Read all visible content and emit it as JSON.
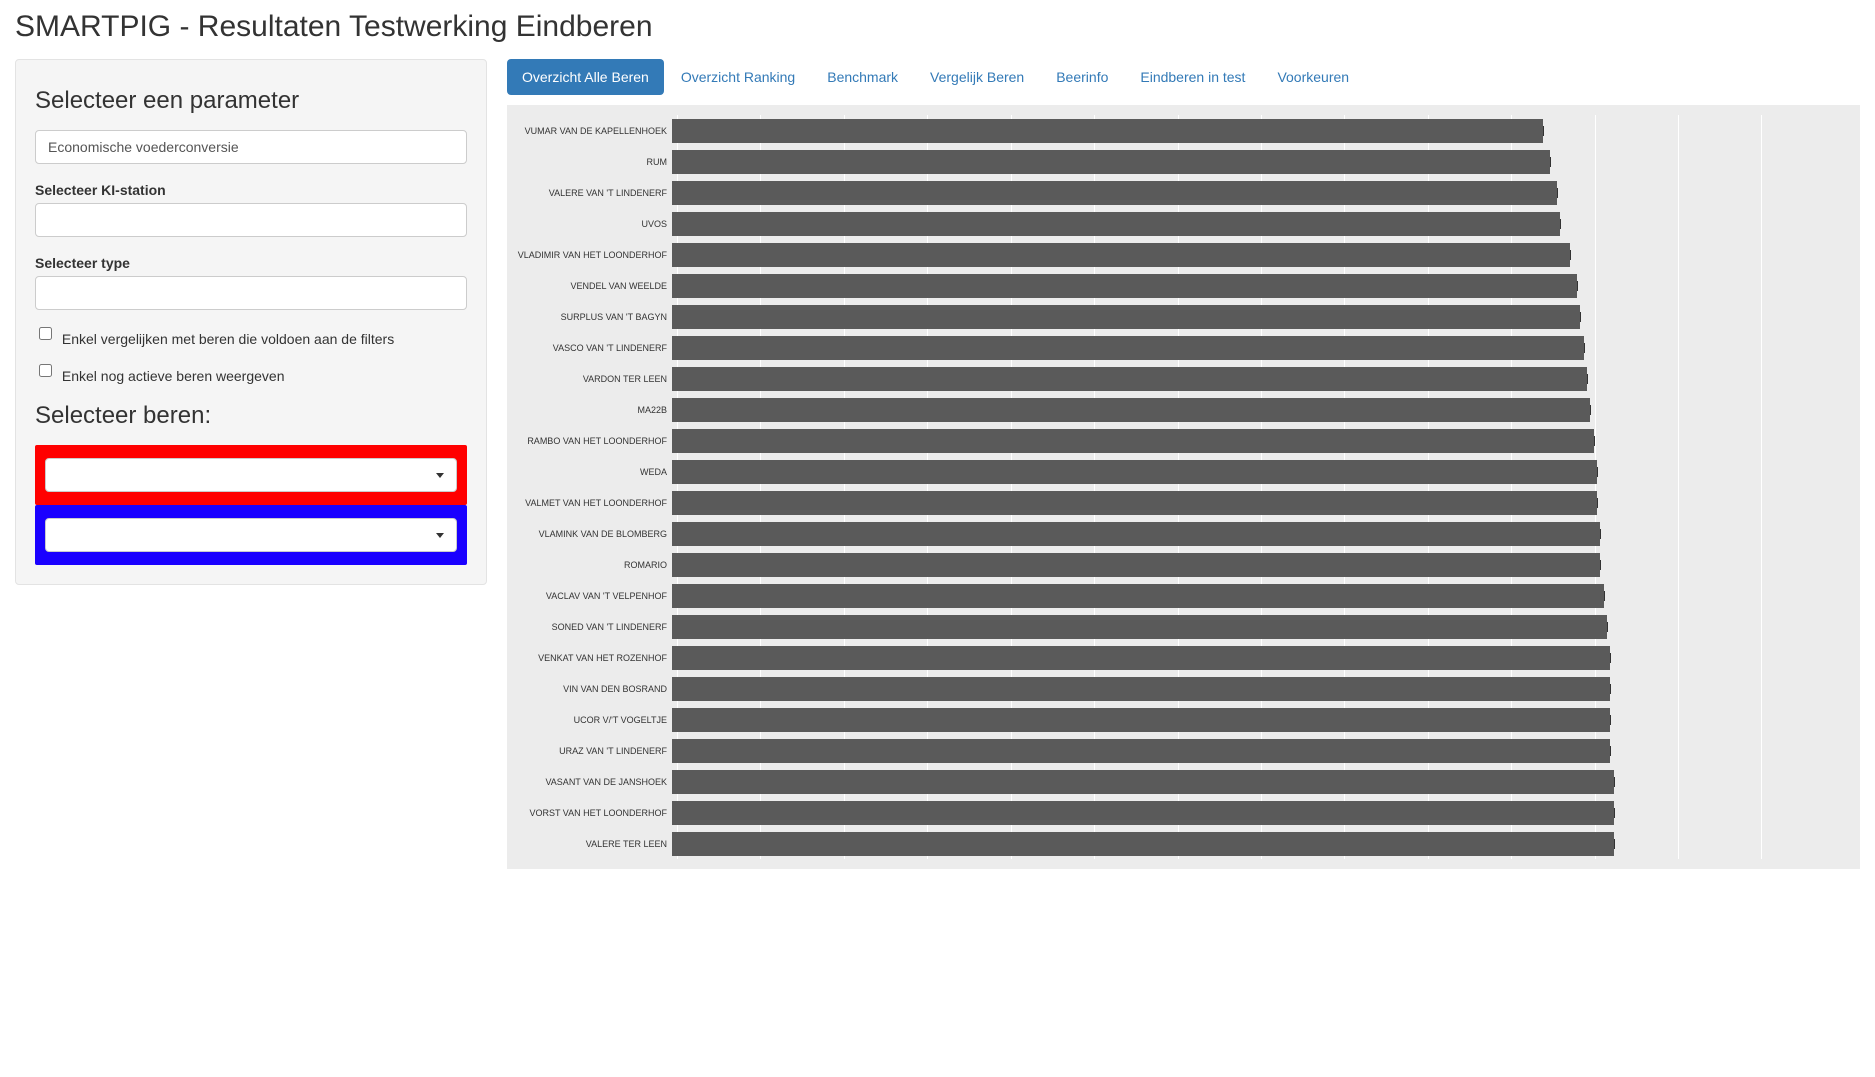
{
  "page_title": "SMARTPIG - Resultaten Testwerking Eindberen",
  "sidebar": {
    "param_heading": "Selecteer een parameter",
    "param_value": "Economische voederconversie",
    "ki_label": "Selecteer KI-station",
    "ki_value": "",
    "type_label": "Selecteer type",
    "type_value": "",
    "check1_label": "Enkel vergelijken met beren die voldoen aan de filters",
    "check2_label": "Enkel nog actieve beren weergeven",
    "beren_heading": "Selecteer beren:",
    "color1": "#ff0000",
    "color2": "#1a00ff"
  },
  "tabs": [
    {
      "label": "Overzicht Alle Beren",
      "active": true
    },
    {
      "label": "Overzicht Ranking",
      "active": false
    },
    {
      "label": "Benchmark",
      "active": false
    },
    {
      "label": "Vergelijk Beren",
      "active": false
    },
    {
      "label": "Beerinfo",
      "active": false
    },
    {
      "label": "Eindberen in test",
      "active": false
    },
    {
      "label": "Voorkeuren",
      "active": false
    }
  ],
  "chart_data": {
    "type": "bar",
    "orientation": "horizontal",
    "title": "",
    "xlabel": "",
    "ylabel": "",
    "xlim": [
      0,
      3.5
    ],
    "grid_divisions": 14,
    "categories": [
      "VUMAR VAN DE KAPELLENHOEK",
      "RUM",
      "VALERE VAN 'T LINDENERF",
      "UVOS",
      "VLADIMIR VAN HET LOONDERHOF",
      "VENDEL VAN WEELDE",
      "SURPLUS VAN 'T BAGYN",
      "VASCO VAN 'T LINDENERF",
      "VARDON TER LEEN",
      "MA22B",
      "RAMBO VAN HET LOONDERHOF",
      "WEDA",
      "VALMET VAN HET LOONDERHOF",
      "VLAMINK VAN DE BLOMBERG",
      "ROMARIO",
      "VACLAV VAN 'T VELPENHOF",
      "SONED VAN 'T LINDENERF",
      "VENKAT VAN HET ROZENHOF",
      "VIN VAN DEN BOSRAND",
      "UCOR V/'T VOGELTJE",
      "URAZ VAN 'T LINDENERF",
      "VASANT VAN DE JANSHOEK",
      "VORST VAN HET LOONDERHOF",
      "VALERE TER LEEN"
    ],
    "values": [
      2.6,
      2.62,
      2.64,
      2.65,
      2.68,
      2.7,
      2.71,
      2.72,
      2.73,
      2.74,
      2.75,
      2.76,
      2.76,
      2.77,
      2.77,
      2.78,
      2.79,
      2.8,
      2.8,
      2.8,
      2.8,
      2.81,
      2.81,
      2.81
    ],
    "errors": [
      0.06,
      0.07,
      0.06,
      0.06,
      0.06,
      0.06,
      0.06,
      0.07,
      0.07,
      0.07,
      0.07,
      0.1,
      0.07,
      0.06,
      0.06,
      0.07,
      0.08,
      0.08,
      0.07,
      0.08,
      0.08,
      0.1,
      0.06,
      0.06
    ]
  }
}
